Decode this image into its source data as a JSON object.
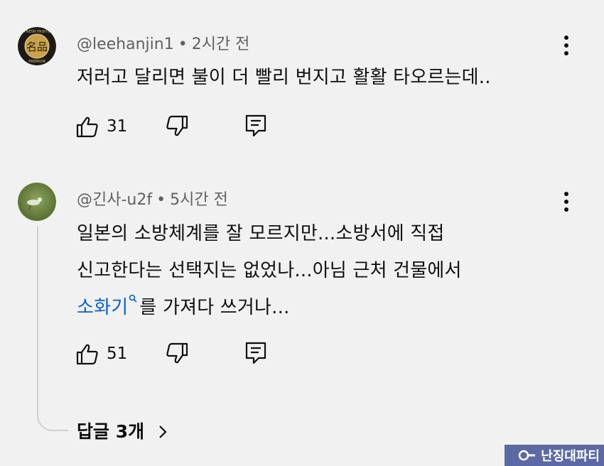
{
  "comments": [
    {
      "handle": "@leehanjin1",
      "time": "2시간 전",
      "lines": [
        "저러고 달리면 불이 더 빨리 번지고 활활 타오르는데.."
      ],
      "likes": "31",
      "avatar_text": "名品",
      "avatar_ring_text_top": "FRESH FRUITS",
      "avatar_ring_text_bottom": "PREMIUM"
    },
    {
      "handle": "@긴사-u2f",
      "time": "5시간 전",
      "lines": [
        "일본의 소방체계를 잘 모르지만...소방서에 직접",
        "신고한다는 선택지는 없었나...아님 근처 건물에서"
      ],
      "link_text": "소화기",
      "line3_rest": "를 가져다 쓰거나...",
      "likes": "51",
      "replies_label": "답글 3개"
    }
  ],
  "dot": "•",
  "watermark": "난징대파티",
  "colors": {
    "background": "#f1f1f1",
    "link": "#065fd4",
    "meta": "#606060"
  }
}
